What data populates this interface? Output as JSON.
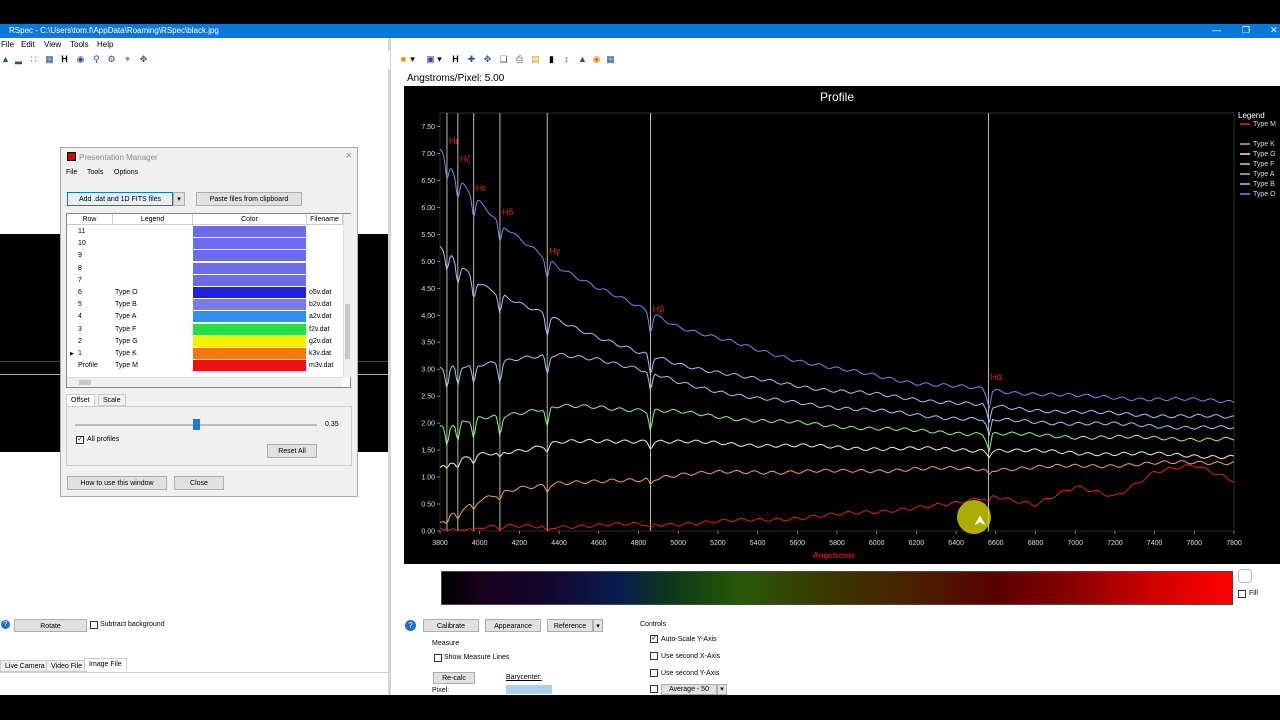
{
  "window": {
    "title": "RSpec - C:\\Users\\tom.f\\AppData\\Roaming\\RSpec\\black.jpg"
  },
  "menu": [
    "File",
    "Edit",
    "View",
    "Tools",
    "Help"
  ],
  "left_panel": {
    "rotate_label": "Rotate",
    "subtract_bg_label": "Subtract background",
    "tabs": [
      "Live Camera",
      "Video File",
      "Image File"
    ]
  },
  "presentation_manager": {
    "title": "Presentation Manager",
    "menu": [
      "File",
      "Tools",
      "Options"
    ],
    "add_button": "Add .dat and 1D FITS files",
    "paste_button": "Paste files from clipboard",
    "columns": [
      "Row",
      "Legend",
      "Color",
      "Filename"
    ],
    "rows": [
      {
        "row": "11",
        "legend": "",
        "color": "#6b6bf0",
        "file": ""
      },
      {
        "row": "10",
        "legend": "",
        "color": "#6b6bf0",
        "file": ""
      },
      {
        "row": "9",
        "legend": "",
        "color": "#6b6bf0",
        "file": ""
      },
      {
        "row": "8",
        "legend": "",
        "color": "#6b6bf0",
        "file": ""
      },
      {
        "row": "7",
        "legend": "",
        "color": "#6b6bf0",
        "file": ""
      },
      {
        "row": "6",
        "legend": "Type O",
        "color": "#2020e0",
        "file": "o5v.dat"
      },
      {
        "row": "5",
        "legend": "Type B",
        "color": "#7a7af0",
        "file": "b2v.dat"
      },
      {
        "row": "4",
        "legend": "Type A",
        "color": "#2e8ff0",
        "file": "a2v.dat"
      },
      {
        "row": "3",
        "legend": "Type F",
        "color": "#22e040",
        "file": "f2v.dat"
      },
      {
        "row": "2",
        "legend": "Type G",
        "color": "#f5f000",
        "file": "g2v.dat"
      },
      {
        "row": "1",
        "legend": "Type K",
        "color": "#f07a10",
        "file": "k3v.dat"
      },
      {
        "row": "Profile",
        "legend": "Type M",
        "color": "#ee1010",
        "file": "m3v.dat"
      }
    ],
    "tabs": [
      "Offset",
      "Scale"
    ],
    "offset_value": "0.35",
    "offset_fraction": 0.5,
    "all_profiles_label": "All profiles",
    "reset_button": "Reset All",
    "howto_button": "How to use this window",
    "close_button": "Close"
  },
  "plot": {
    "angstroms_per_pixel": "Angstroms/Pixel: 5.00",
    "fill_label": "Fill"
  },
  "chart_data": {
    "type": "line",
    "title": "Profile",
    "xlabel": "Angstroms",
    "ylabel": "",
    "xlim": [
      3800,
      7800
    ],
    "ylim": [
      0,
      7.75
    ],
    "xticks": [
      "3800",
      "4000",
      "4200",
      "4400",
      "4600",
      "4800",
      "5000",
      "5200",
      "5400",
      "5600",
      "5800",
      "6000",
      "6200",
      "6400",
      "6600",
      "6800",
      "7000",
      "7200",
      "7400",
      "7600",
      "7800"
    ],
    "yticks": [
      "0.00",
      "0.50",
      "1.00",
      "1.50",
      "2.00",
      "2.50",
      "3.00",
      "3.50",
      "4.00",
      "4.50",
      "5.00",
      "5.50",
      "6.00",
      "6.50",
      "7.00",
      "7.50"
    ],
    "legend_title": "Legend",
    "legend_position": "right",
    "grid": false,
    "line_markers": [
      {
        "label": "Hε",
        "x": 3835
      },
      {
        "label": "Hζ",
        "x": 3890
      },
      {
        "label": "Hε",
        "x": 3970
      },
      {
        "label": "Hδ",
        "x": 4102
      },
      {
        "label": "Hγ",
        "x": 4340
      },
      {
        "label": "Hβ",
        "x": 4861
      },
      {
        "label": "Hα",
        "x": 6563
      }
    ],
    "series": [
      {
        "name": "Type M",
        "color": "#e02020",
        "x": [
          3800,
          4200,
          4600,
          5000,
          5400,
          5800,
          6000,
          6200,
          6400,
          6600,
          6800,
          7000,
          7200,
          7400,
          7600,
          7800
        ],
        "values": [
          0.05,
          0.08,
          0.1,
          0.14,
          0.2,
          0.3,
          0.35,
          0.45,
          0.5,
          0.65,
          0.5,
          0.8,
          0.65,
          1.1,
          1.2,
          0.95
        ]
      },
      {
        "name": "Type K",
        "color": "#f0a060",
        "x": [
          3800,
          4000,
          4200,
          4400,
          4600,
          4800,
          5000,
          5400,
          5800,
          6200,
          6600,
          7000,
          7400,
          7800
        ],
        "values": [
          0.2,
          0.55,
          0.8,
          0.9,
          0.9,
          0.95,
          1.05,
          1.1,
          1.1,
          1.15,
          1.15,
          1.2,
          1.25,
          1.28
        ]
      },
      {
        "name": "Type G",
        "color": "#f5f0c0",
        "x": [
          3800,
          4000,
          4200,
          4400,
          4600,
          4800,
          5000,
          5400,
          5800,
          6200,
          6600,
          7000,
          7400,
          7800
        ],
        "values": [
          1.2,
          1.4,
          1.5,
          1.65,
          1.65,
          1.68,
          1.65,
          1.6,
          1.55,
          1.52,
          1.5,
          1.45,
          1.42,
          1.38
        ]
      },
      {
        "name": "Type F",
        "color": "#90f090",
        "x": [
          3800,
          4000,
          4200,
          4400,
          4600,
          4800,
          5000,
          5400,
          5800,
          6200,
          6600,
          7000,
          7400,
          7800
        ],
        "values": [
          1.9,
          2.1,
          2.2,
          2.3,
          2.3,
          2.25,
          2.2,
          2.05,
          1.95,
          1.85,
          1.8,
          1.75,
          1.72,
          1.7
        ]
      },
      {
        "name": "Type A",
        "color": "#a0c8f0",
        "x": [
          3800,
          4000,
          4200,
          4400,
          4600,
          4800,
          5000,
          5400,
          5800,
          6200,
          6600,
          7000,
          7400,
          7800
        ],
        "values": [
          3.0,
          3.1,
          3.2,
          3.25,
          3.2,
          3.0,
          2.75,
          2.45,
          2.3,
          2.15,
          2.05,
          2.0,
          1.95,
          1.9
        ]
      },
      {
        "name": "Type B",
        "color": "#b8b8f8",
        "x": [
          3800,
          4000,
          4200,
          4400,
          4600,
          4800,
          5000,
          5400,
          5800,
          6200,
          6600,
          7000,
          7400,
          7800
        ],
        "values": [
          5.3,
          4.6,
          4.2,
          3.9,
          3.6,
          3.3,
          3.1,
          2.8,
          2.6,
          2.45,
          2.3,
          2.2,
          2.15,
          2.1
        ]
      },
      {
        "name": "Type O",
        "color": "#8080f0",
        "x": [
          3800,
          3900,
          4000,
          4100,
          4200,
          4400,
          4600,
          4800,
          5000,
          5400,
          5800,
          6200,
          6600,
          7000,
          7400,
          7800
        ],
        "values": [
          7.1,
          6.5,
          6.1,
          5.7,
          5.4,
          4.9,
          4.5,
          4.15,
          3.8,
          3.35,
          3.0,
          2.75,
          2.6,
          2.5,
          2.45,
          2.4
        ]
      }
    ]
  },
  "bottom": {
    "calibrate": "Calibrate",
    "appearance": "Appearance",
    "reference": "Reference",
    "measure_label": "Measure",
    "show_measure_lines": "Show Measure Lines",
    "recalc": "Re-calc",
    "barycenter": "Barycenter:",
    "pixel": "Pixel:",
    "controls_label": "Controls",
    "auto_scale": "Auto-Scale Y-Axis",
    "second_x": "Use second X-Axis",
    "second_y": "Use second Y-Axis",
    "average": "Average - 50"
  }
}
